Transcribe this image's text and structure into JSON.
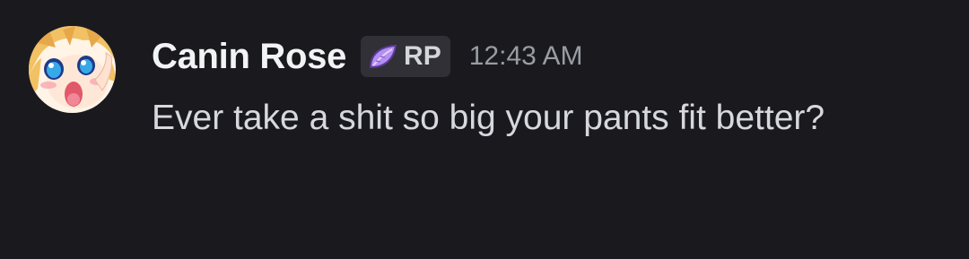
{
  "message": {
    "author": {
      "name": "Canin Rose",
      "avatar_icon": "anime-avatar",
      "name_color": "#f2f3f5"
    },
    "tag": {
      "icon": "purple-leaf-icon",
      "text": "RP",
      "icon_color": "#b48ef0"
    },
    "timestamp": "12:43 AM",
    "content": "Ever take a shit so big your pants fit better?"
  }
}
